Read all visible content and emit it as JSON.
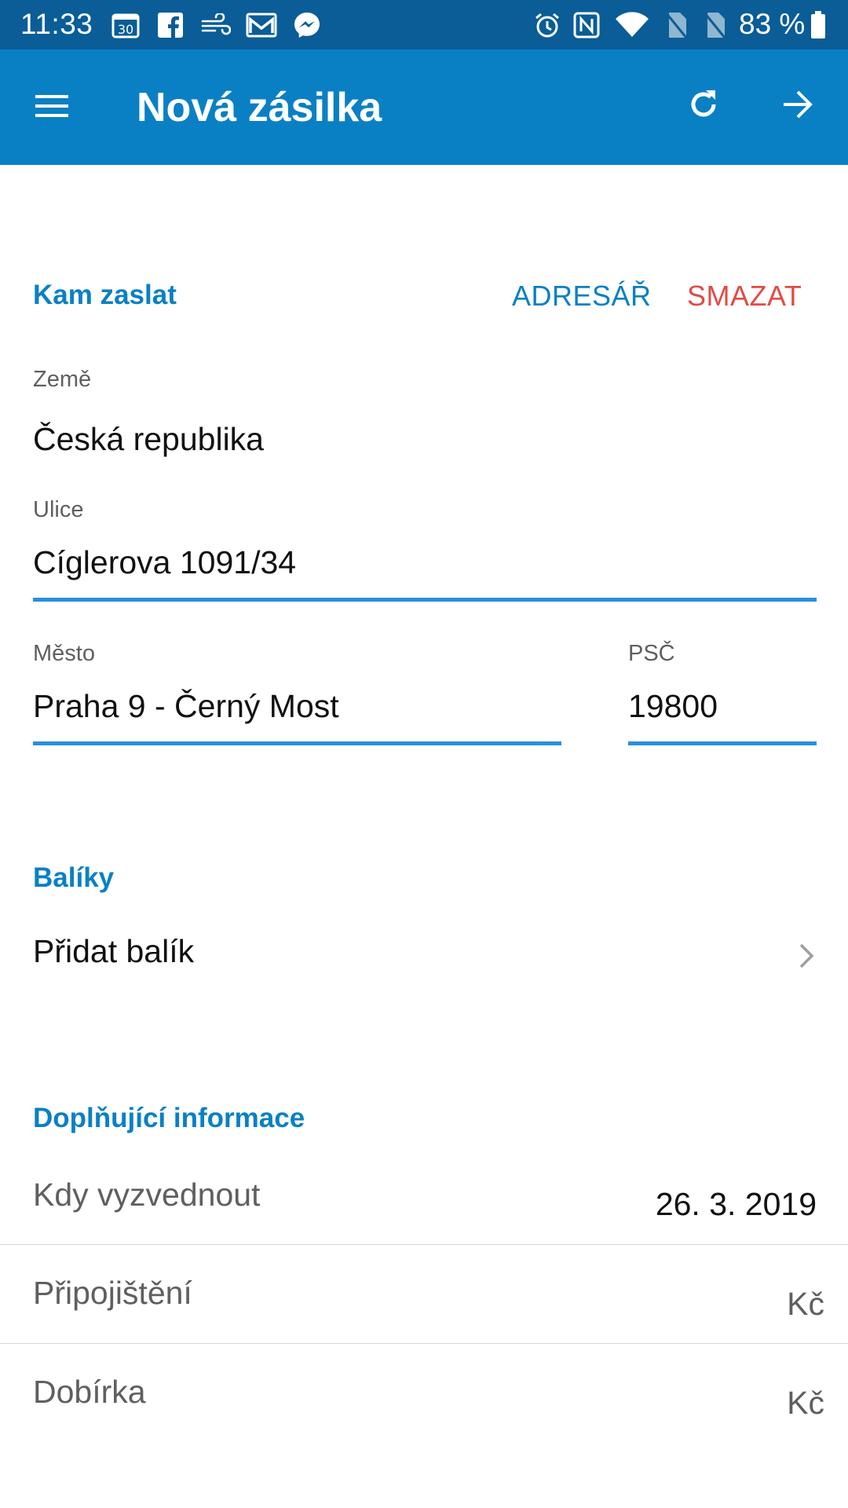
{
  "status_bar": {
    "time": "11:33",
    "battery": "83 %",
    "left_icons": [
      "calendar-icon",
      "facebook-icon",
      "wind-icon",
      "gmail-icon",
      "messenger-icon"
    ],
    "calendar_day": "30",
    "right_icons": [
      "alarm-icon",
      "nfc-icon",
      "wifi-icon",
      "no-sim-icon",
      "no-sim-icon",
      "battery-icon"
    ]
  },
  "app_bar": {
    "title": "Nová zásilka",
    "menu_icon": "menu-icon",
    "refresh_icon": "refresh-icon",
    "next_icon": "arrow-right-icon",
    "color": "#0a80c4"
  },
  "destination": {
    "title": "Kam zaslat",
    "address_book_button": "ADRESÁŘ",
    "delete_button": "SMAZAT",
    "delete_color": "#e04b45",
    "country_label": "Země",
    "country_value": "Česká republika",
    "street_label": "Ulice",
    "street_value": "Cíglerova 1091/34",
    "city_label": "Město",
    "city_value": "Praha 9 - Černý Most",
    "zip_label": "PSČ",
    "zip_value": "19800"
  },
  "packages": {
    "title": "Balíky",
    "add_package": "Přidat balík",
    "chevron_icon": "chevron-right-icon"
  },
  "additional": {
    "title": "Doplňující informace",
    "pickup_label": "Kdy vyzvednout",
    "pickup_value": "26. 3. 2019",
    "insurance_label": "Připojištění",
    "insurance_unit": "Kč",
    "cod_label": "Dobírka",
    "cod_unit": "Kč"
  },
  "colors": {
    "accent": "#0a80c4",
    "status_bar": "#0a5d97",
    "field_underline": "#2a8fe0"
  }
}
